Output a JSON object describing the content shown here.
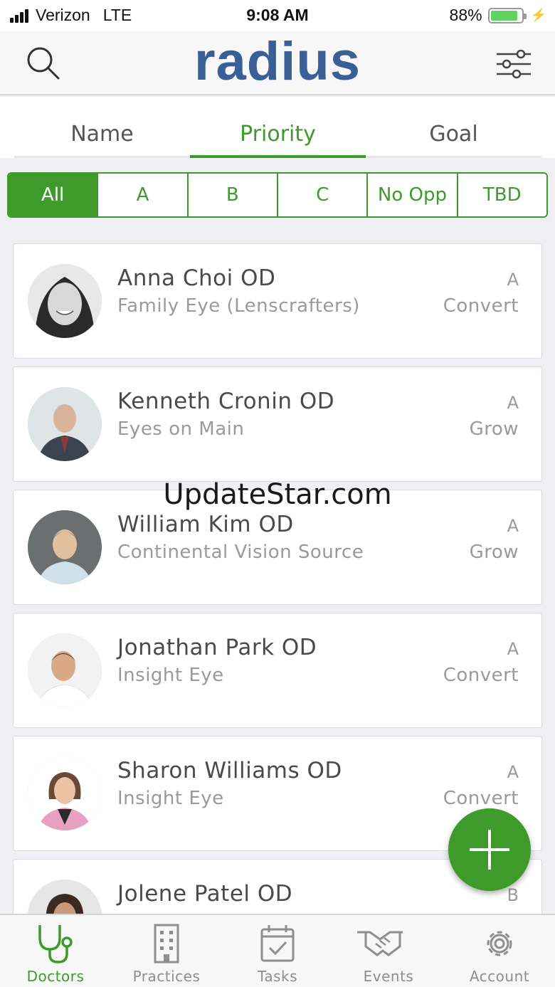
{
  "status_bar": {
    "carrier": "Verizon",
    "network": "LTE",
    "time": "9:08 AM",
    "battery": "88%",
    "battery_level": 0.88
  },
  "header": {
    "logo": "radius",
    "search_icon": "search-icon",
    "filter_icon": "sliders-icon"
  },
  "sort_tabs": [
    {
      "label": "Name"
    },
    {
      "label": "Priority"
    },
    {
      "label": "Goal"
    }
  ],
  "active_sort_tab": "Priority",
  "priority_filters": [
    {
      "label": "All"
    },
    {
      "label": "A"
    },
    {
      "label": "B"
    },
    {
      "label": "C"
    },
    {
      "label": "No Opp"
    },
    {
      "label": "TBD"
    }
  ],
  "active_priority_filter": "All",
  "doctors": [
    {
      "name": "Anna Choi OD",
      "practice": "Family Eye (Lenscrafters)",
      "priority": "A",
      "goal": "Convert"
    },
    {
      "name": "Kenneth Cronin OD",
      "practice": "Eyes on Main",
      "priority": "A",
      "goal": "Grow"
    },
    {
      "name": "William Kim OD",
      "practice": "Continental Vision Source",
      "priority": "A",
      "goal": "Grow"
    },
    {
      "name": "Jonathan Park OD",
      "practice": "Insight Eye",
      "priority": "A",
      "goal": "Convert"
    },
    {
      "name": "Sharon Williams OD",
      "practice": "Insight Eye",
      "priority": "A",
      "goal": "Convert"
    },
    {
      "name": "Jolene Patel OD",
      "practice": "",
      "priority": "B",
      "goal": ""
    }
  ],
  "watermark": "UpdateStar.com",
  "fab": {
    "icon": "plus-icon"
  },
  "bottom_tabs": [
    {
      "label": "Doctors",
      "icon": "stethoscope-icon"
    },
    {
      "label": "Practices",
      "icon": "building-icon"
    },
    {
      "label": "Tasks",
      "icon": "calendar-check-icon"
    },
    {
      "label": "Events",
      "icon": "handshake-icon"
    },
    {
      "label": "Account",
      "icon": "gear-icon"
    }
  ],
  "active_bottom_tab": "Doctors",
  "colors": {
    "accent": "#3e9a2a",
    "logo": "#3a5f97",
    "background": "#efeff4"
  }
}
